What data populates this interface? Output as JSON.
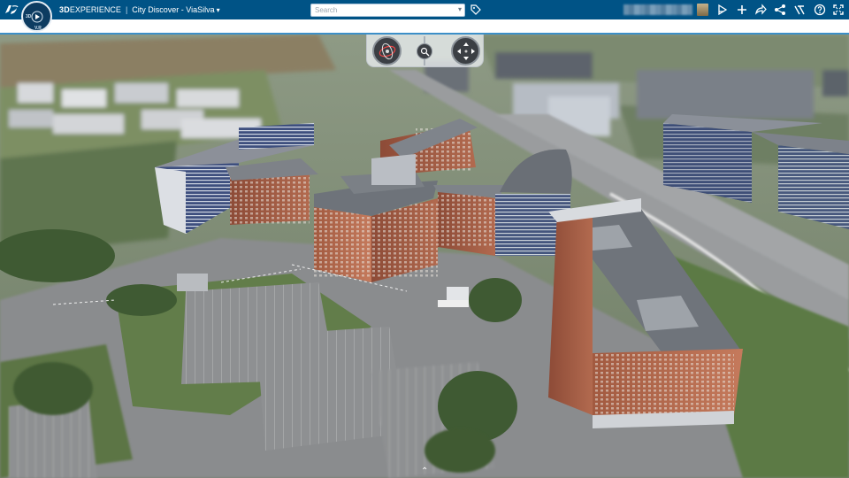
{
  "header": {
    "brand_prefix": "3D",
    "brand_name": "EXPERIENCE",
    "separator": "|",
    "app_name": "City Discover - ViaSilva",
    "app_chevron": "▾",
    "search_placeholder": "Search",
    "search_dropdown": "▾"
  },
  "compass": {
    "label_top": "3D",
    "label_bottom": "V.R"
  },
  "toolbar_icons": [
    "tag-icon",
    "user-avatar",
    "share-icon",
    "add-icon",
    "forward-icon",
    "network-icon",
    "tools-icon",
    "help-icon",
    "fullscreen-icon"
  ],
  "colors": {
    "topbar": "#005386",
    "accent": "#3c8fc8"
  },
  "navigation": [
    "orbit-control",
    "zoom-control",
    "pan-control"
  ],
  "bottom_toggle": "⌃"
}
